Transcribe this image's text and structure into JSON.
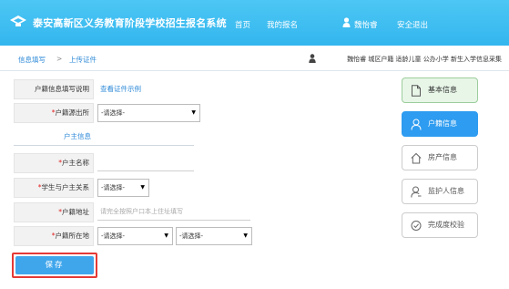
{
  "header": {
    "system_title": "泰安高新区义务教育阶段学校招生报名系统",
    "nav": [
      "首页",
      "我的报名",
      "魏怡睿",
      "安全退出"
    ]
  },
  "breadcrumb": {
    "items": [
      "信息填写",
      "上传证件"
    ],
    "separator": ">"
  },
  "applicant_info": "魏怡睿 城区户籍 适龄儿童 公办小学 新生入学信息采集",
  "form": {
    "household_desc": {
      "label": "户籍信息填写说明",
      "link": "查看证件示例"
    },
    "household_origin": {
      "label": "户籍源出所",
      "value": "-请选择-"
    },
    "section_tab": "户主信息",
    "head_name": {
      "label": "户主名称",
      "value": ""
    },
    "relation": {
      "label": "学生与户主关系",
      "value": "-请选择-"
    },
    "address": {
      "label": "户籍地址",
      "placeholder": "请完全按照户口本上住址填写"
    },
    "location": {
      "label": "户籍所在地",
      "value1": "-请选择-",
      "value2": "-请选择-"
    },
    "save_label": "保存"
  },
  "steps": [
    {
      "label": "基本信息",
      "state": "done",
      "icon": "document-icon"
    },
    {
      "label": "户籍信息",
      "state": "active",
      "icon": "person-icon"
    },
    {
      "label": "房产信息",
      "state": "pending",
      "icon": "house-icon"
    },
    {
      "label": "监护人信息",
      "state": "pending",
      "icon": "guardian-icon"
    },
    {
      "label": "完成度校验",
      "state": "pending",
      "icon": "check-circle-icon"
    }
  ],
  "colors": {
    "header_bg": "#3fbdf2",
    "link": "#2e8ad8",
    "active_step": "#2e9cf0",
    "done_step": "#e8f6e8",
    "required": "#e02020",
    "highlight_border": "#e53935"
  }
}
